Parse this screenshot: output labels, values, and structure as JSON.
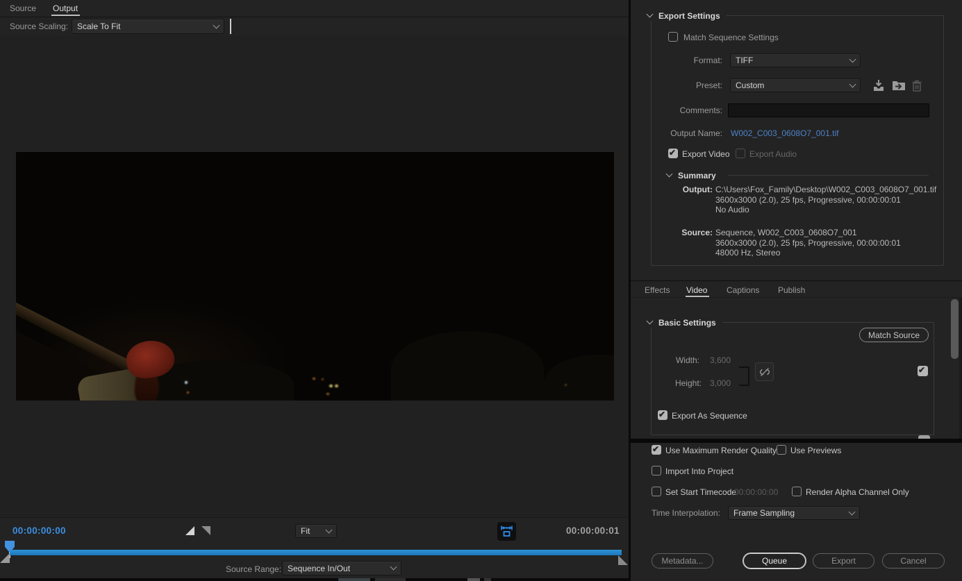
{
  "colors": {
    "accent_blue": "#2f8ceb",
    "timecode_blue": "#3c8ee0",
    "link_blue": "#4d82c8",
    "timeline_bar_blue": "#1d7fc0"
  },
  "left_panel": {
    "tabs": [
      {
        "label": "Source",
        "active": false
      },
      {
        "label": "Output",
        "active": true
      }
    ],
    "source_scaling": {
      "label": "Source Scaling:",
      "value": "Scale To Fit"
    },
    "transport": {
      "current_timecode": "00:00:00:00",
      "duration_timecode": "00:00:00:01",
      "zoom_select_value": "Fit",
      "source_range": {
        "label": "Source Range:",
        "value": "Sequence In/Out"
      }
    }
  },
  "export_settings": {
    "title": "Export Settings",
    "match_sequence_settings": {
      "label": "Match Sequence Settings",
      "checked": false
    },
    "format": {
      "label": "Format:",
      "value": "TIFF"
    },
    "preset": {
      "label": "Preset:",
      "value": "Custom"
    },
    "comments": {
      "label": "Comments:",
      "value": ""
    },
    "output_name": {
      "label": "Output Name:",
      "value": "W002_C003_0608O7_001.tif"
    },
    "export_video": {
      "label": "Export Video",
      "checked": true
    },
    "export_audio": {
      "label": "Export Audio",
      "checked": false,
      "disabled": true
    },
    "summary": {
      "title": "Summary",
      "output": {
        "label": "Output:",
        "lines": [
          "C:\\Users\\Fox_Family\\Desktop\\W002_C003_0608O7_001.tif",
          "3600x3000 (2.0), 25 fps, Progressive, 00:00:00:01",
          "No Audio"
        ]
      },
      "source": {
        "label": "Source:",
        "lines": [
          "Sequence, W002_C003_0608O7_001",
          "3600x3000 (2.0), 25 fps, Progressive, 00:00:00:01",
          "48000 Hz, Stereo"
        ]
      }
    }
  },
  "settings_tabs": [
    {
      "label": "Effects",
      "active": false
    },
    {
      "label": "Video",
      "active": true
    },
    {
      "label": "Captions",
      "active": false
    },
    {
      "label": "Publish",
      "active": false
    }
  ],
  "video_tab": {
    "basic_settings_title": "Basic Settings",
    "match_source_button": "Match Source",
    "width": {
      "label": "Width:",
      "value": "3,600"
    },
    "height": {
      "label": "Height:",
      "value": "3,000"
    },
    "size_link_enabled": false,
    "constrain_checkbox_checked": true,
    "export_as_sequence": {
      "label": "Export As Sequence",
      "checked": true
    }
  },
  "render_options": {
    "use_maximum_render_quality": {
      "label": "Use Maximum Render Quality",
      "checked": true
    },
    "use_previews": {
      "label": "Use Previews",
      "checked": false
    },
    "import_into_project": {
      "label": "Import Into Project",
      "checked": false
    },
    "set_start_timecode": {
      "label": "Set Start Timecode",
      "checked": false,
      "value": "00:00:00:00"
    },
    "render_alpha_channel_only": {
      "label": "Render Alpha Channel Only",
      "checked": false
    },
    "time_interpolation": {
      "label": "Time Interpolation:",
      "value": "Frame Sampling"
    }
  },
  "footer_buttons": {
    "metadata": "Metadata...",
    "queue": "Queue",
    "export": "Export",
    "cancel": "Cancel"
  },
  "icons": {
    "save_preset": "save-preset-icon",
    "import_preset": "import-preset-icon",
    "delete_preset": "delete-preset-icon",
    "broken_link": "broken-link-icon",
    "fit_width": "fit-width-icon"
  }
}
